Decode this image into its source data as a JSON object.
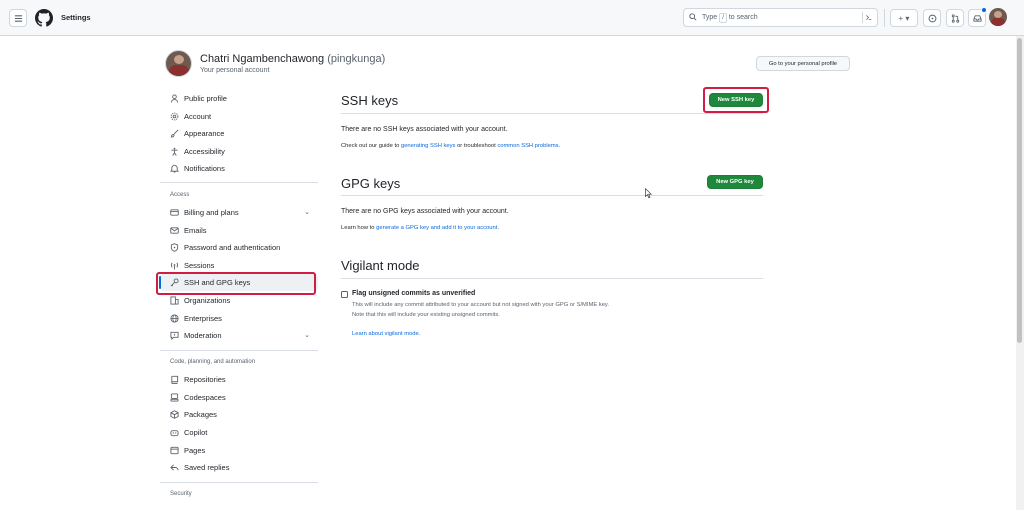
{
  "header": {
    "title": "Settings",
    "search_placeholder_prefix": "Type",
    "search_key": "/",
    "search_placeholder_suffix": "to search",
    "plus_label": "+ ▾"
  },
  "profile": {
    "name": "Chatri Ngambenchawong",
    "handle": "(pingkunga)",
    "subtitle": "Your personal account",
    "go_profile_button": "Go to your personal profile"
  },
  "sidebar": {
    "items_top": [
      {
        "label": "Public profile",
        "icon": "person-icon"
      },
      {
        "label": "Account",
        "icon": "gear-icon"
      },
      {
        "label": "Appearance",
        "icon": "paintbrush-icon"
      },
      {
        "label": "Accessibility",
        "icon": "accessibility-icon"
      },
      {
        "label": "Notifications",
        "icon": "bell-icon"
      }
    ],
    "access_heading": "Access",
    "items_access": [
      {
        "label": "Billing and plans",
        "icon": "credit-card-icon"
      },
      {
        "label": "Emails",
        "icon": "mail-icon"
      },
      {
        "label": "Password and authentication",
        "icon": "shield-lock-icon"
      },
      {
        "label": "Sessions",
        "icon": "broadcast-icon"
      },
      {
        "label": "SSH and GPG keys",
        "icon": "key-icon"
      },
      {
        "label": "Organizations",
        "icon": "organization-icon"
      },
      {
        "label": "Enterprises",
        "icon": "globe-icon"
      },
      {
        "label": "Moderation",
        "icon": "report-icon"
      }
    ],
    "code_heading": "Code, planning, and automation",
    "items_code": [
      {
        "label": "Repositories",
        "icon": "repo-icon"
      },
      {
        "label": "Codespaces",
        "icon": "codespaces-icon"
      },
      {
        "label": "Packages",
        "icon": "package-icon"
      },
      {
        "label": "Copilot",
        "icon": "copilot-icon"
      },
      {
        "label": "Pages",
        "icon": "browser-icon"
      },
      {
        "label": "Saved replies",
        "icon": "reply-icon"
      }
    ],
    "security_heading": "Security"
  },
  "ssh": {
    "title": "SSH keys",
    "new_button": "New SSH key",
    "empty_text": "There are no SSH keys associated with your account.",
    "guide_prefix": "Check out our guide to",
    "guide_link": "generating SSH keys",
    "guide_mid": "or troubleshoot",
    "guide_link2": "common SSH problems",
    "guide_end": "."
  },
  "gpg": {
    "title": "GPG keys",
    "new_button": "New GPG key",
    "empty_text": "There are no GPG keys associated with your account.",
    "learn_prefix": "Learn how to",
    "learn_link": "generate a GPG key and add it to your account",
    "learn_end": "."
  },
  "vigilant": {
    "title": "Vigilant mode",
    "checkbox_label": "Flag unsigned commits as unverified",
    "desc1": "This will include any commit attributed to your account but not signed with your GPG or S/MIME key.",
    "desc2": "Note that this will include your existing unsigned commits.",
    "learn_link": "Learn about vigilant mode."
  },
  "colors": {
    "accent": "#0969da",
    "primary_button": "#1f883d",
    "highlight_box": "#cf1d44",
    "selected_indicator": "#0969da"
  }
}
